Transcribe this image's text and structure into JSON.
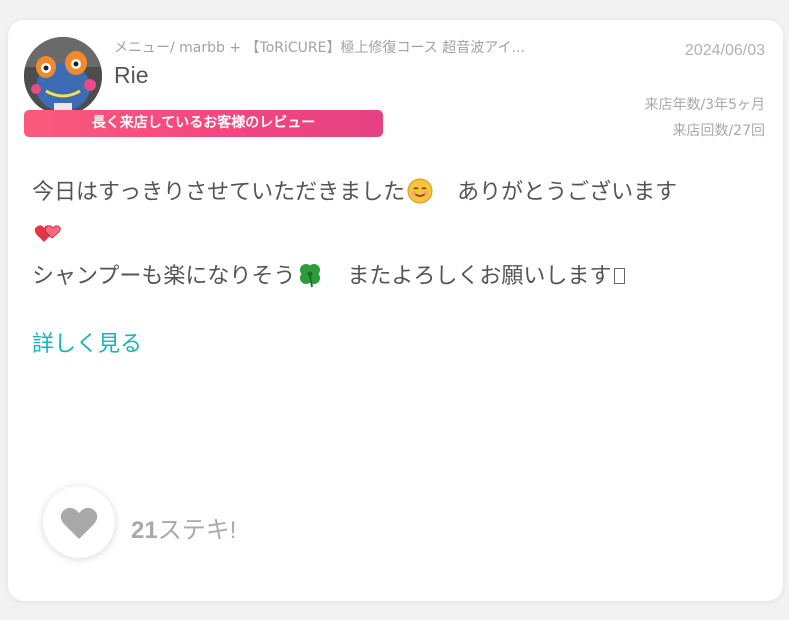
{
  "review": {
    "menu_line": "メニュー/ marbb + 【ToRiCURE】極上修復コース 超音波アイ...",
    "reviewer_name": "Rie",
    "date": "2024/06/03",
    "visit_years": "来店年数/3年5ヶ月",
    "visit_count": "来店回数/27回",
    "badge": "長く来店しているお客様のレビュー",
    "text_line1_a": "今日はすっきりさせていただきました",
    "text_line1_b": "ありがとうございます",
    "text_line2_a": "シャンプーも楽になりそう",
    "text_line2_b": "またよろしくお願いします",
    "read_more": "詳しく見る"
  },
  "likes": {
    "count": "21",
    "label": "ステキ!"
  },
  "icons": {
    "avatar": "monster-plush-avatar",
    "emoji1": "smiling-face-emoji",
    "emoji2": "red-hearts-emoji",
    "emoji3": "four-leaf-clover-emoji",
    "like": "heart-icon"
  },
  "colors": {
    "badge_start": "#fb5a7c",
    "badge_end": "#e64283",
    "link": "#19b3b3",
    "heart": "#a9a9a9"
  }
}
